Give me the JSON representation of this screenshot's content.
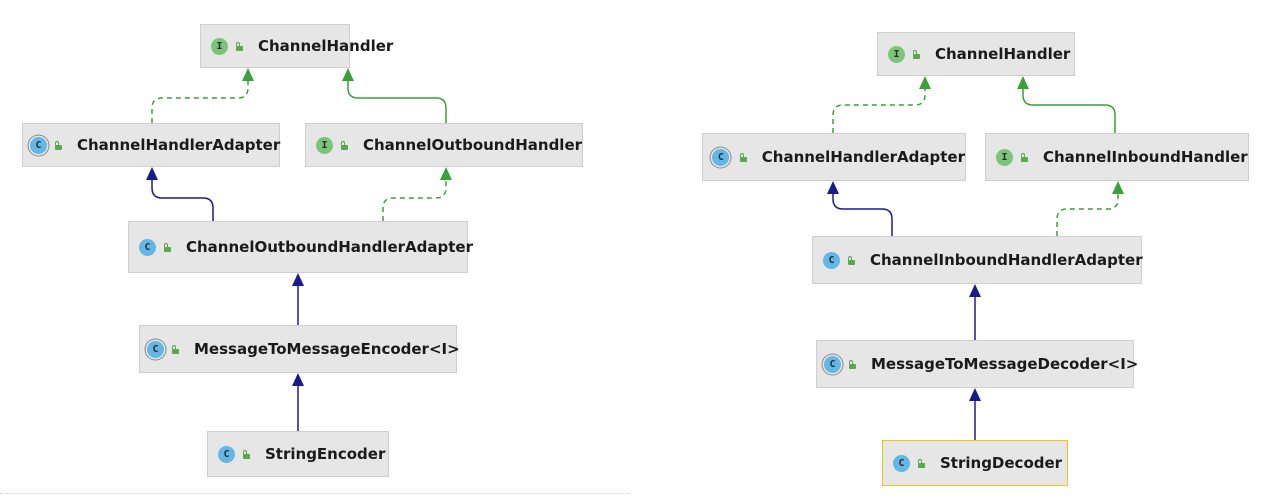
{
  "diagrams": [
    {
      "nodes": [
        {
          "id": "l_handler",
          "label": "ChannelHandler",
          "kind": "interface"
        },
        {
          "id": "l_adapter",
          "label": "ChannelHandlerAdapter",
          "kind": "abstract"
        },
        {
          "id": "l_outbound",
          "label": "ChannelOutboundHandler",
          "kind": "interface"
        },
        {
          "id": "l_outadapter",
          "label": "ChannelOutboundHandlerAdapter",
          "kind": "class"
        },
        {
          "id": "l_m2m",
          "label": "MessageToMessageEncoder<I>",
          "kind": "abstract"
        },
        {
          "id": "l_enc",
          "label": "StringEncoder",
          "kind": "class"
        }
      ]
    },
    {
      "nodes": [
        {
          "id": "r_handler",
          "label": "ChannelHandler",
          "kind": "interface"
        },
        {
          "id": "r_adapter",
          "label": "ChannelHandlerAdapter",
          "kind": "abstract"
        },
        {
          "id": "r_inbound",
          "label": "ChannelInboundHandler",
          "kind": "interface"
        },
        {
          "id": "r_inadapter",
          "label": "ChannelInboundHandlerAdapter",
          "kind": "class"
        },
        {
          "id": "r_m2m",
          "label": "MessageToMessageDecoder<I>",
          "kind": "abstract"
        },
        {
          "id": "r_dec",
          "label": "StringDecoder",
          "kind": "class",
          "selected": true
        }
      ]
    }
  ],
  "edges": [
    {
      "from": "l_adapter",
      "to": "l_handler",
      "type": "implements"
    },
    {
      "from": "l_outbound",
      "to": "l_handler",
      "type": "extends-interface"
    },
    {
      "from": "l_outadapter",
      "to": "l_adapter",
      "type": "extends"
    },
    {
      "from": "l_outadapter",
      "to": "l_outbound",
      "type": "implements"
    },
    {
      "from": "l_m2m",
      "to": "l_outadapter",
      "type": "extends"
    },
    {
      "from": "l_enc",
      "to": "l_m2m",
      "type": "extends"
    },
    {
      "from": "r_adapter",
      "to": "r_handler",
      "type": "implements"
    },
    {
      "from": "r_inbound",
      "to": "r_handler",
      "type": "extends-interface"
    },
    {
      "from": "r_inadapter",
      "to": "r_adapter",
      "type": "extends"
    },
    {
      "from": "r_inadapter",
      "to": "r_inbound",
      "type": "implements"
    },
    {
      "from": "r_m2m",
      "to": "r_inadapter",
      "type": "extends"
    },
    {
      "from": "r_dec",
      "to": "r_m2m",
      "type": "extends"
    }
  ],
  "badges": {
    "interface": "I",
    "class": "C",
    "abstract": "C"
  },
  "colors": {
    "class_edge": "#1a1a8c",
    "interface_edge": "#3aa13a",
    "node_bg": "#e6e6e6",
    "selected_border": "#f0c419"
  }
}
